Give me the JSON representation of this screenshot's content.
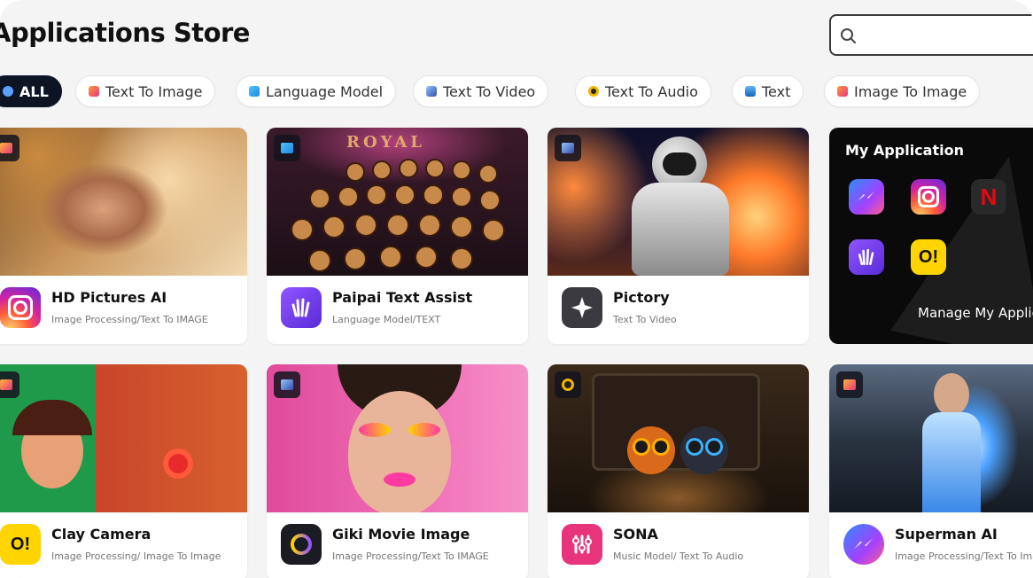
{
  "page": {
    "title": "Applications Store"
  },
  "search": {
    "placeholder": ""
  },
  "filters": [
    {
      "label": "ALL",
      "active": true
    },
    {
      "label": "Text To Image",
      "icon": "image-emoji-icon"
    },
    {
      "label": "Language Model",
      "icon": "language-emoji-icon"
    },
    {
      "label": "Text To Video",
      "icon": "video-emoji-icon"
    },
    {
      "label": "Text To Audio",
      "icon": "audio-emoji-icon"
    },
    {
      "label": "Text",
      "icon": "text-emoji-icon"
    },
    {
      "label": "Image To Image",
      "icon": "image-emoji-icon"
    }
  ],
  "apps": [
    {
      "name": "HD Pictures AI",
      "category": "Image Processing/Text To IMAGE",
      "icon": "instagram-style-icon"
    },
    {
      "name": "Paipai Text Assist",
      "category": "Language Model/TEXT",
      "icon": "wave-hand-icon"
    },
    {
      "name": "Pictory",
      "category": "Text To Video",
      "icon": "sparkle-icon"
    },
    {
      "name": "Clay Camera",
      "category": "Image Processing/ Image To Image",
      "icon": "oi-icon"
    },
    {
      "name": "Giki Movie Image",
      "category": "Image Processing/Text To IMAGE",
      "icon": "orbit-icon"
    },
    {
      "name": "SONA",
      "category": "Music Model/ Text To Audio",
      "icon": "equalizer-icon"
    },
    {
      "name": "Superman AI",
      "category": "Image Processing/Text To Image",
      "icon": "messenger-icon"
    }
  ],
  "my_application": {
    "title": "My Application",
    "manage_label": "Manage My Applications",
    "icons": [
      "messenger-icon",
      "instagram-icon",
      "netflix-icon",
      "wave-hand-icon",
      "oi-icon"
    ]
  },
  "art": {
    "royal_text": "ROYAL"
  },
  "colors": {
    "chip_active_bg": "#0d1424",
    "page_bg": "#f4f4f5",
    "card_bg": "#ffffff"
  }
}
